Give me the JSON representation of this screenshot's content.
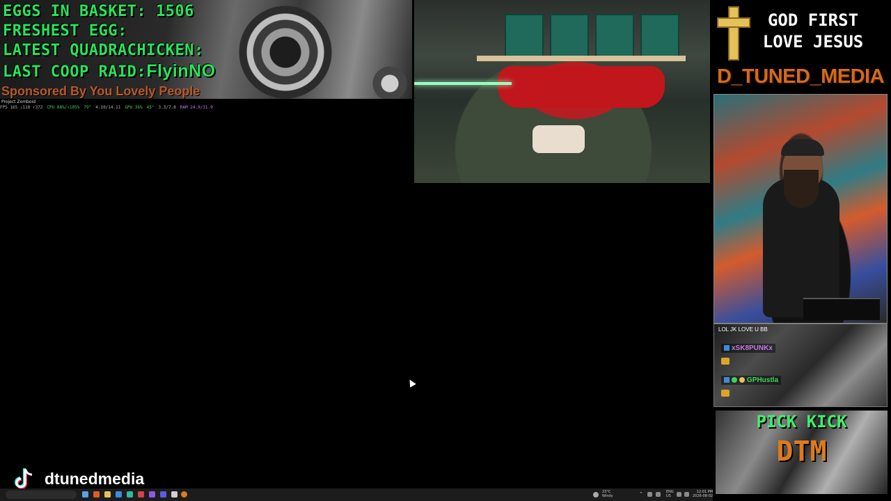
{
  "stats": {
    "eggs_label": "EGGS IN BASKET:",
    "eggs_value": "1506",
    "freshest_label": "FRESHEST EGG:",
    "quadrachicken_label": "LATEST QUADRACHICKEN:",
    "coop_raid_label": "LAST COOP RAID:",
    "coop_raid_value": "FlyinNO",
    "sponsor": "Sponsored By You Lovely People"
  },
  "overlay_bar": {
    "app_title": "Project Zomboid",
    "fps": "FPS 165 ↓110 ↑372",
    "cpu": "CPU 88%/↑105%",
    "cpu_temp": "79°",
    "cpu_clock": "4.10/14.11",
    "gpu": "GPU 36%",
    "gpu_temp": "45°",
    "vram": "3.3/7.8",
    "ram": "RAM 24.9/31.9"
  },
  "banner": {
    "line1": "GOD FIRST",
    "line2": "LOVE JESUS",
    "brand": "D_TUNED_MEDIA"
  },
  "chat": {
    "message": "LOL JK LOVE U BB",
    "users": [
      {
        "name": "xSK8PUNKx",
        "color": "#c57be8"
      },
      {
        "name": "GPHustla",
        "color": "#3fd35e"
      }
    ]
  },
  "kick": {
    "line1": "PICK KICK",
    "line2": "DTM"
  },
  "tiktok": {
    "handle": "dtunedmedia"
  },
  "taskbar": {
    "weather_temp": "23°C",
    "weather_desc": "Windy",
    "lang": "ENG",
    "region": "US",
    "time": "12:01 PM",
    "date": "2026-08-02"
  },
  "colors": {
    "stat_green": "#27e45a",
    "brand_orange": "#d26b1b",
    "kick_green": "#3ef06a",
    "kick_orange": "#e07a1c"
  }
}
